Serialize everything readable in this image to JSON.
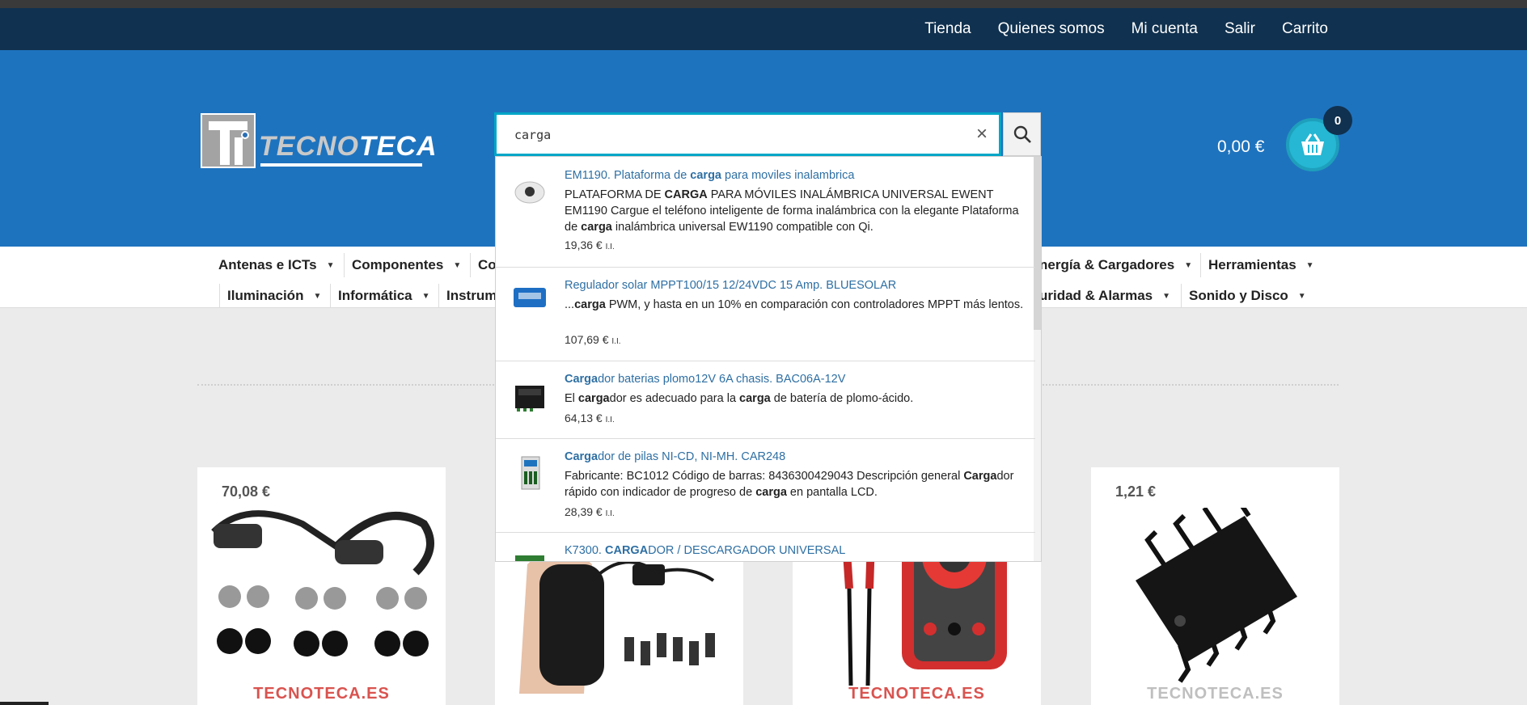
{
  "topnav": {
    "items": [
      "Tienda",
      "Quienes somos",
      "Mi cuenta",
      "Salir",
      "Carrito"
    ]
  },
  "logo": {
    "part1": "TECNO",
    "part2": "TECA"
  },
  "search": {
    "value": "carga",
    "clear_symbol": "×"
  },
  "cart": {
    "total": "0,00 €",
    "count": "0"
  },
  "menu": {
    "row1": [
      "Antenas e ICTs",
      "Componentes",
      "Co",
      "nergía & Cargadores",
      "Herramientas"
    ],
    "row2": [
      "Iluminación",
      "Informática",
      "Instrum",
      "uridad & Alarmas",
      "Sonido y Disco"
    ]
  },
  "results": [
    {
      "title_pre": "EM1190. Plataforma de ",
      "title_hl": "carga",
      "title_post": " para moviles inalambrica",
      "desc_html_parts": [
        "PLATAFORMA DE ",
        "CARGA",
        " PARA MÓVILES INALÁMBRICA UNIVERSAL EWENT EM1190 Cargue el teléfono inteligente de forma inalámbrica con la elegante Plataforma de ",
        "carga",
        " inalámbrica universal EW1190 compatible con Qi."
      ],
      "price": "19,36 €",
      "tax": "I.I."
    },
    {
      "title_pre": "Regulador solar MPPT100/15 12/24VDC 15 Amp. BLUESOLAR",
      "title_hl": "",
      "title_post": "",
      "desc_html_parts": [
        "...",
        "carga",
        " PWM, y hasta en un 10% en comparación con controladores MPPT más lentos."
      ],
      "price": "107,69 €",
      "tax": "I.I."
    },
    {
      "title_pre": "",
      "title_hl": "Carga",
      "title_post": "dor baterias plomo12V 6A chasis. BAC06A-12V",
      "desc_html_parts": [
        "El ",
        "carga",
        "dor es adecuado para la ",
        "carga",
        " de batería de plomo-ácido."
      ],
      "price": "64,13 €",
      "tax": "I.I."
    },
    {
      "title_pre": "",
      "title_hl": "Carga",
      "title_post": "dor de pilas NI-CD, NI-MH. CAR248",
      "desc_html_parts": [
        "Fabricante: BC1012 Código de barras: 8436300429043 Descripción general ",
        "Carga",
        "dor rápido con indicador de progreso de ",
        "carga",
        " en pantalla LCD."
      ],
      "price": "28,39 €",
      "tax": "I.I."
    },
    {
      "title_pre": "K7300. ",
      "title_hl": "CARGA",
      "title_post": "DOR / DESCARGADOR UNIVERSAL",
      "desc_html_parts": [],
      "price": "",
      "tax": ""
    }
  ],
  "products": [
    {
      "price": "70,08 €",
      "watermark": "TECNOTECA.ES"
    },
    {
      "price": "",
      "watermark": ""
    },
    {
      "price": "",
      "watermark": "TECNOTECA.ES"
    },
    {
      "price": "1,21 €",
      "watermark": "TECNOTECA.ES"
    }
  ],
  "colors": {
    "topbar": "#10314f",
    "header": "#1e73be",
    "accent": "#25b7d3",
    "link": "#2e6fa3"
  }
}
